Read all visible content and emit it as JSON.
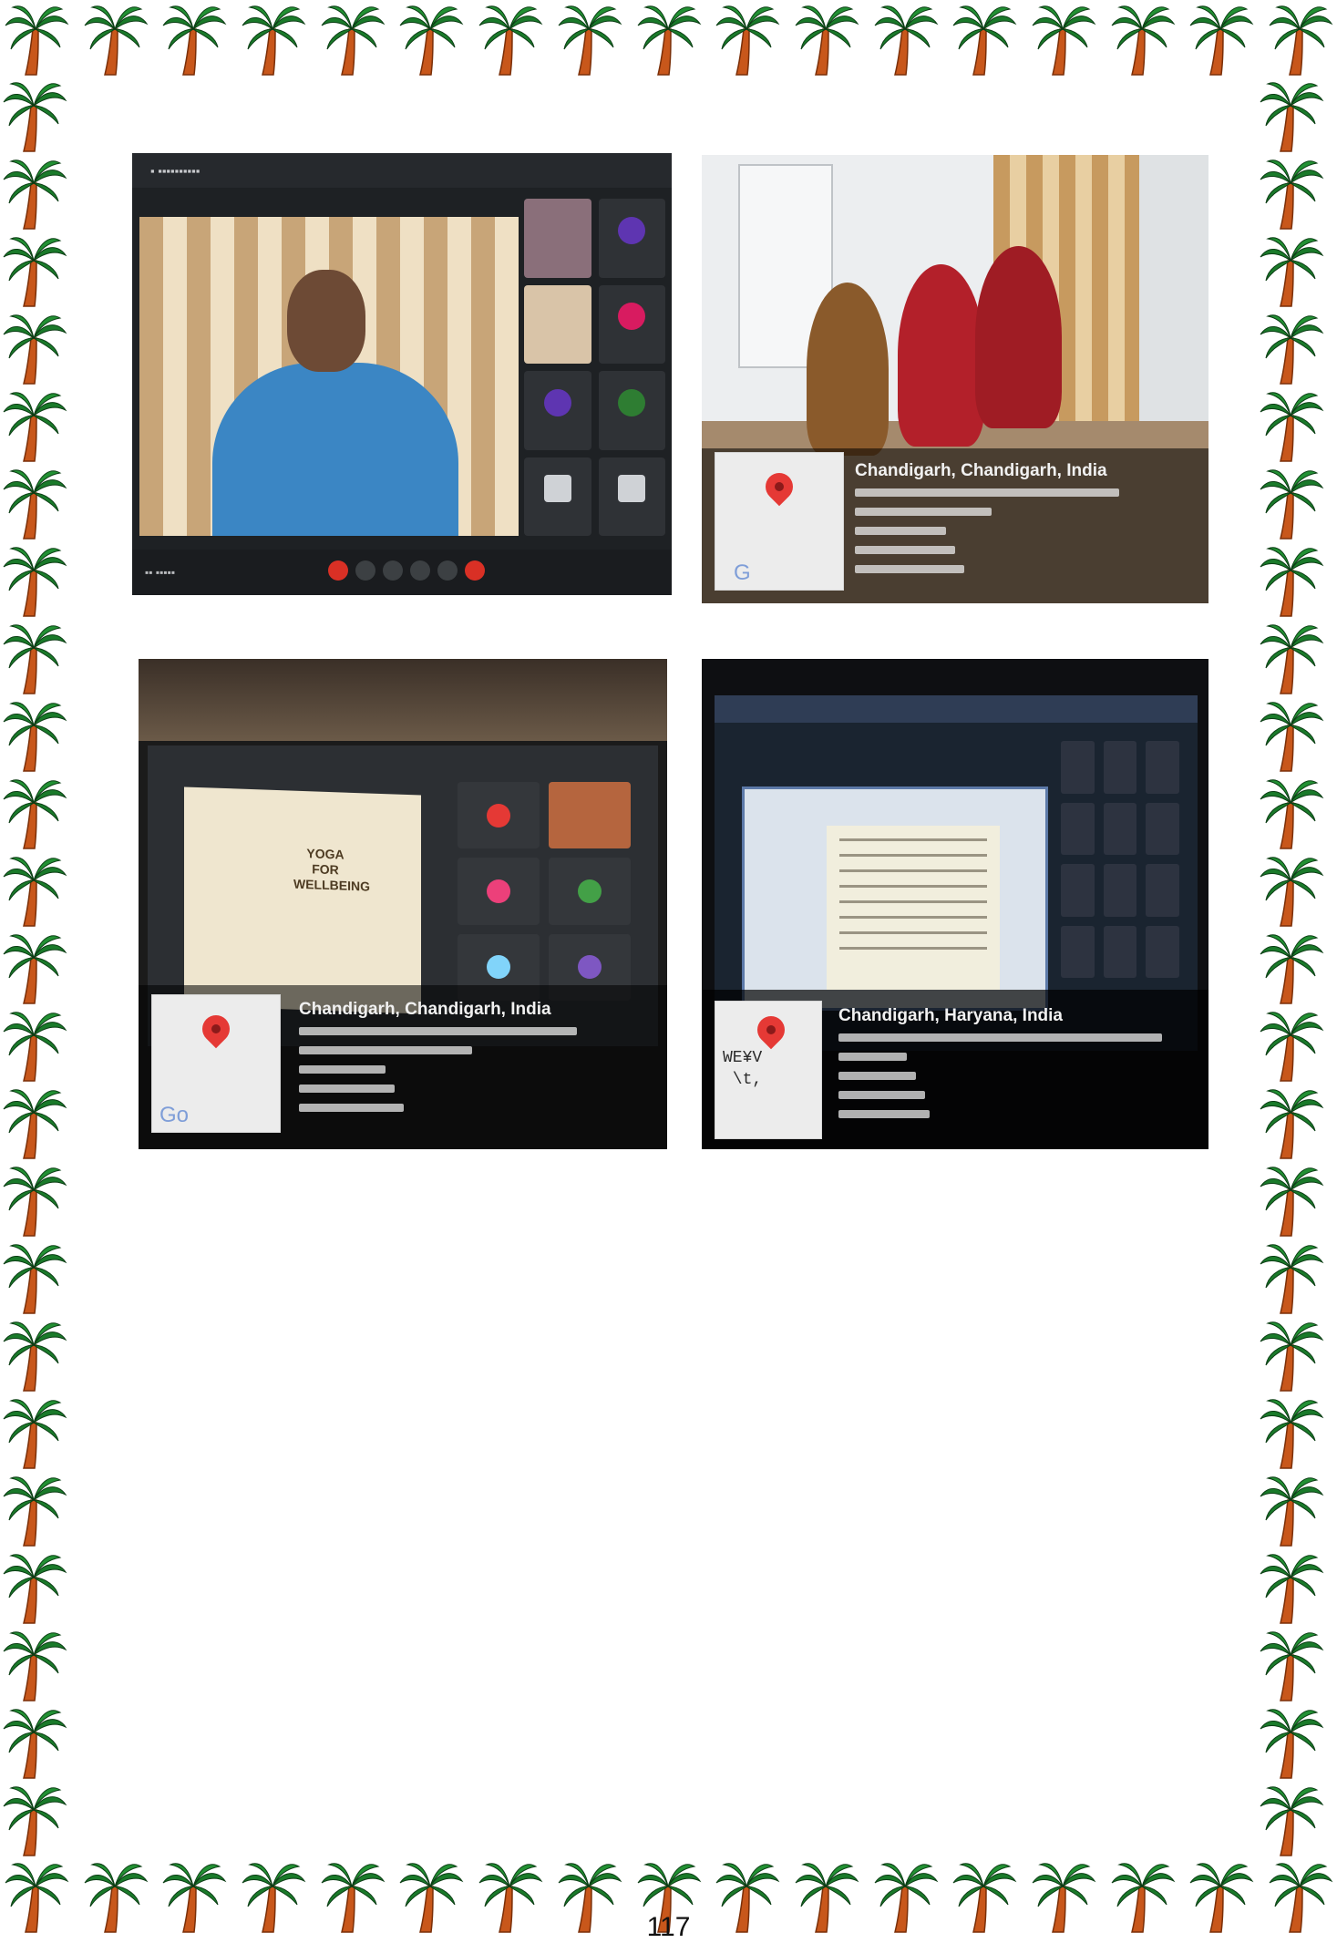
{
  "photos": [
    {
      "name": "online-session-screenshot",
      "geotag": null
    },
    {
      "name": "participants-room-photo",
      "geotag": {
        "location": "Chandigarh, Chandigarh, India",
        "map_logo": "G"
      }
    },
    {
      "name": "laptop-presentation-photo",
      "geotag": {
        "location": "Chandigarh, Chandigarh, India",
        "map_logo": "Go"
      }
    },
    {
      "name": "desktop-presentation-photo",
      "geotag": {
        "location": "Chandigarh, Haryana, India",
        "map_text": "WE¥V\n \\t,"
      }
    }
  ],
  "slide_text": "YOGA FOR WELLBEING",
  "page_number": "117",
  "colors": {
    "palm_trunk": "#c8571b",
    "palm_leaves": "#1a7a2a",
    "map_pin": "#e53935"
  }
}
